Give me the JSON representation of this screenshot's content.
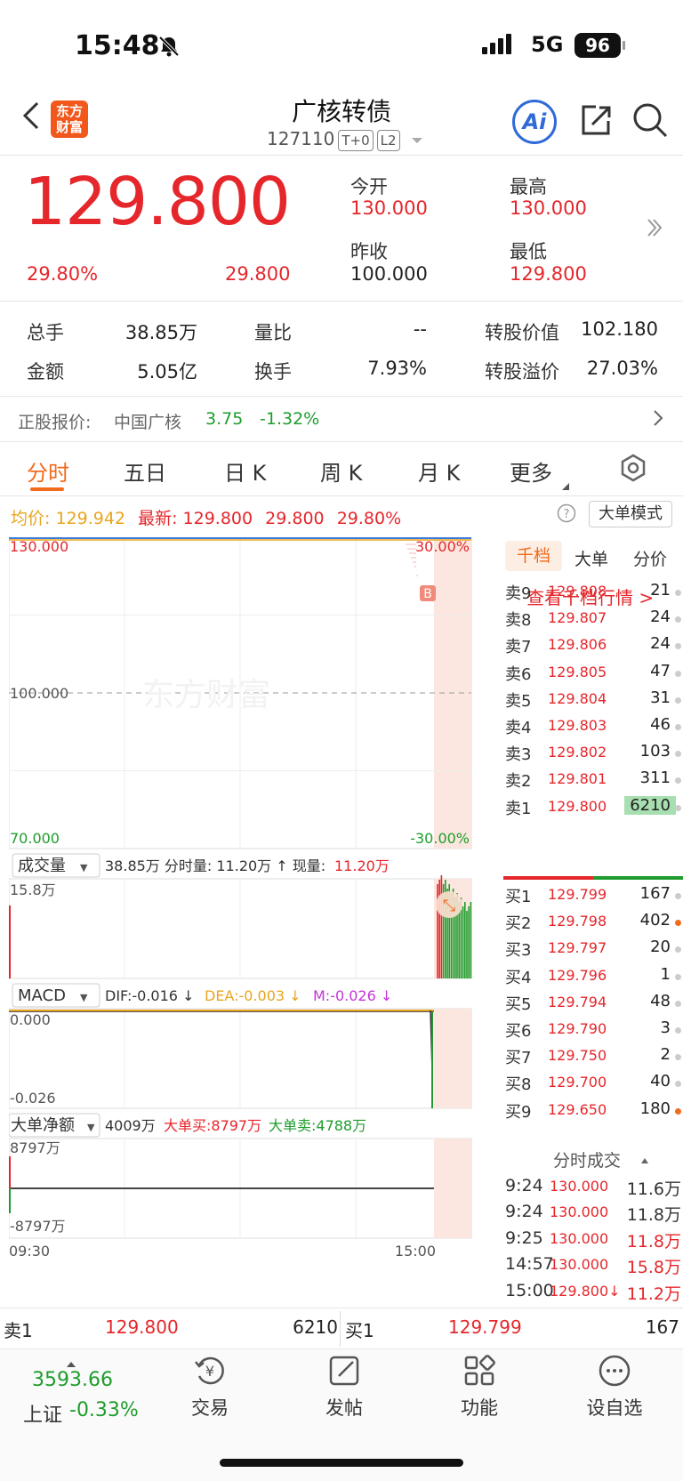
{
  "status_bar": {
    "time": "15:48",
    "network": "5G",
    "battery": "96"
  },
  "header": {
    "title": "广核转债",
    "code": "127110",
    "tag1": "T+0",
    "tag2": "L2",
    "logo_text": "东方财富",
    "ai_label": "Ai"
  },
  "quote": {
    "price": "129.800",
    "change_pct": "29.80%",
    "change": "29.800",
    "open_label": "今开",
    "open": "130.000",
    "high_label": "最高",
    "high": "130.000",
    "prev_label": "昨收",
    "prev": "100.000",
    "low_label": "最低",
    "low": "129.800"
  },
  "stats": {
    "vol_label": "总手",
    "vol": "38.85万",
    "ratio_label": "量比",
    "ratio": "--",
    "conv_value_label": "转股价值",
    "conv_value": "102.180",
    "amount_label": "金额",
    "amount": "5.05亿",
    "turnover_label": "换手",
    "turnover": "7.93%",
    "premium_label": "转股溢价",
    "premium": "27.03%"
  },
  "underlying": {
    "label": "正股报价:",
    "name": "中国广核",
    "price": "3.75",
    "change": "-1.32%"
  },
  "tabs": [
    "分时",
    "五日",
    "日 K",
    "周 K",
    "月 K",
    "更多"
  ],
  "avg_line": {
    "avg_label": "均价:",
    "avg": "129.942",
    "latest_label": "最新:",
    "latest": "129.800",
    "chg": "29.800",
    "pct": "29.80%",
    "mode_button": "大单模式"
  },
  "chart_data": [
    {
      "type": "line",
      "title": "分时",
      "ylim": [
        70,
        130
      ],
      "y_ticks_left": [
        "130.000",
        "100.000",
        "70.000"
      ],
      "y_ticks_right": [
        "30.00%",
        "-30.00%"
      ],
      "watermark": "东方财富",
      "marker": "B"
    },
    {
      "type": "bar",
      "title": "成交量",
      "selector": "成交量",
      "summary": "38.85万",
      "period_vol_label": "分时量:",
      "period_vol": "11.20万",
      "now_label": "现量:",
      "now": "11.20万",
      "ymax_label": "15.8万"
    },
    {
      "type": "line",
      "title": "MACD",
      "selector": "MACD",
      "dif": "DIF:-0.016",
      "dea": "DEA:-0.003",
      "m": "M:-0.026",
      "y_ticks": [
        "0.000",
        "-0.026"
      ]
    },
    {
      "type": "line",
      "title": "大单净额",
      "selector": "大单净额",
      "net": "4009万",
      "buy": "大单买:8797万",
      "sell": "大单卖:4788万",
      "y_ticks": [
        "8797万",
        "-8797万"
      ],
      "x_ticks": [
        "09:30",
        "15:00"
      ]
    }
  ],
  "panel": {
    "tabs": [
      "千档",
      "大单",
      "分价"
    ],
    "link": "查看千档行情 >",
    "asks": [
      {
        "label": "卖9",
        "price": "129.808",
        "vol": "21"
      },
      {
        "label": "卖8",
        "price": "129.807",
        "vol": "24"
      },
      {
        "label": "卖7",
        "price": "129.806",
        "vol": "24"
      },
      {
        "label": "卖6",
        "price": "129.805",
        "vol": "47"
      },
      {
        "label": "卖5",
        "price": "129.804",
        "vol": "31"
      },
      {
        "label": "卖4",
        "price": "129.803",
        "vol": "46"
      },
      {
        "label": "卖3",
        "price": "129.802",
        "vol": "103"
      },
      {
        "label": "卖2",
        "price": "129.801",
        "vol": "311"
      },
      {
        "label": "卖1",
        "price": "129.800",
        "vol": "6210"
      }
    ],
    "bids": [
      {
        "label": "买1",
        "price": "129.799",
        "vol": "167"
      },
      {
        "label": "买2",
        "price": "129.798",
        "vol": "402"
      },
      {
        "label": "买3",
        "price": "129.797",
        "vol": "20"
      },
      {
        "label": "买4",
        "price": "129.796",
        "vol": "1"
      },
      {
        "label": "买5",
        "price": "129.794",
        "vol": "48"
      },
      {
        "label": "买6",
        "price": "129.790",
        "vol": "3"
      },
      {
        "label": "买7",
        "price": "129.750",
        "vol": "2"
      },
      {
        "label": "买8",
        "price": "129.700",
        "vol": "40"
      },
      {
        "label": "买9",
        "price": "129.650",
        "vol": "180"
      }
    ],
    "trades_title": "分时成交",
    "trades": [
      {
        "time": "9:24",
        "price": "130.000",
        "vol": "11.6万"
      },
      {
        "time": "9:24",
        "price": "130.000",
        "vol": "11.8万"
      },
      {
        "time": "9:25",
        "price": "130.000",
        "vol": "11.8万"
      },
      {
        "time": "14:57",
        "price": "130.000",
        "vol": "15.8万"
      },
      {
        "time": "15:00",
        "price": "129.800↓",
        "vol": "11.2万"
      }
    ]
  },
  "bottom_quote": {
    "sell_label": "卖1",
    "sell_price": "129.800",
    "sell_vol": "6210",
    "buy_label": "买1",
    "buy_price": "129.799",
    "buy_vol": "167"
  },
  "nav": {
    "index_value": "3593.66",
    "index_label": "上证",
    "index_change": "-0.33%",
    "items": [
      "交易",
      "发帖",
      "功能",
      "设自选"
    ]
  }
}
